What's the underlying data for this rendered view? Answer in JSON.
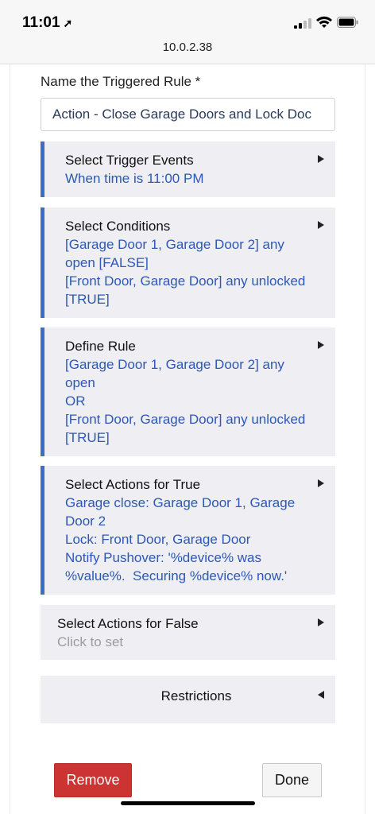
{
  "status_bar": {
    "time": "11:01",
    "url": "10.0.2.38"
  },
  "form": {
    "name_label": "Name the Triggered Rule *",
    "name_value": "Action - Close Garage Doors and Lock Doc"
  },
  "sections": [
    {
      "title": "Select Trigger Events",
      "details": [
        "When time is 11:00 PM"
      ]
    },
    {
      "title": "Select Conditions",
      "details": [
        "[Garage Door 1, Garage Door 2] any",
        "open [FALSE]",
        "[Front Door, Garage Door] any unlocked",
        "[TRUE]"
      ]
    },
    {
      "title": "Define Rule",
      "details": [
        "[Garage Door 1, Garage Door 2] any",
        "open",
        "OR",
        "[Front Door, Garage Door] any unlocked",
        "[TRUE]"
      ]
    },
    {
      "title": "Select Actions for True",
      "details": [
        "Garage close: Garage Door 1, Garage",
        "Door 2",
        "Lock: Front Door, Garage Door",
        "Notify Pushover: '%device% was",
        "%value%.  Securing %device% now.'"
      ]
    },
    {
      "title": "Select Actions for False",
      "placeholder": "Click to set"
    }
  ],
  "restrictions": {
    "title": "Restrictions"
  },
  "buttons": {
    "remove": "Remove",
    "done": "Done"
  },
  "colors": {
    "accent": "#3a6fc4",
    "detail_text": "#2d58b5",
    "remove": "#cc3333"
  }
}
